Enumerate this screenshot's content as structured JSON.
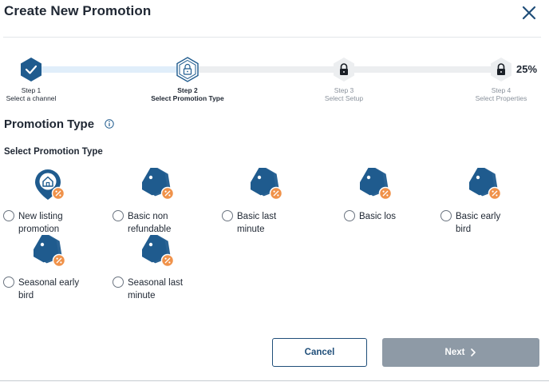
{
  "header": {
    "title": "Create New Promotion"
  },
  "stepper": {
    "percent": "25%",
    "progress_fraction": 0.25,
    "steps": [
      {
        "number": "Step 1",
        "label": "Select a channel",
        "state": "done"
      },
      {
        "number": "Step 2",
        "label": "Select Promotion Type",
        "state": "current"
      },
      {
        "number": "Step 3",
        "label": "Select Setup",
        "state": "locked"
      },
      {
        "number": "Step 4",
        "label": "Select Properties",
        "state": "locked"
      }
    ]
  },
  "section": {
    "title": "Promotion Type",
    "info_icon": "info-icon"
  },
  "subsection": {
    "title": "Select Promotion Type"
  },
  "options": [
    {
      "label_line1": "New listing",
      "label_line2": "promotion",
      "icon": "house-location-icon",
      "selected": false
    },
    {
      "label_line1": "Basic non",
      "label_line2": "refundable",
      "icon": "price-tag-icon",
      "selected": false
    },
    {
      "label_line1": "Basic last",
      "label_line2": "minute",
      "icon": "price-tag-icon",
      "selected": false
    },
    {
      "label_line1": "Basic los",
      "label_line2": "",
      "icon": "price-tag-icon",
      "selected": false
    },
    {
      "label_line1": "Basic early",
      "label_line2": "bird",
      "icon": "price-tag-icon",
      "selected": false
    },
    {
      "label_line1": "Seasonal early",
      "label_line2": "bird",
      "icon": "price-tag-icon",
      "selected": false
    },
    {
      "label_line1": "Seasonal last",
      "label_line2": "minute",
      "icon": "price-tag-icon",
      "selected": false
    }
  ],
  "footer": {
    "cancel_label": "Cancel",
    "next_label": "Next"
  },
  "colors": {
    "primary": "#1f5b8e",
    "badge": "#f0924a",
    "disabled_button": "#8e9aa6",
    "progress_done": "#e0eefa",
    "progress_todo": "#eceef0"
  }
}
